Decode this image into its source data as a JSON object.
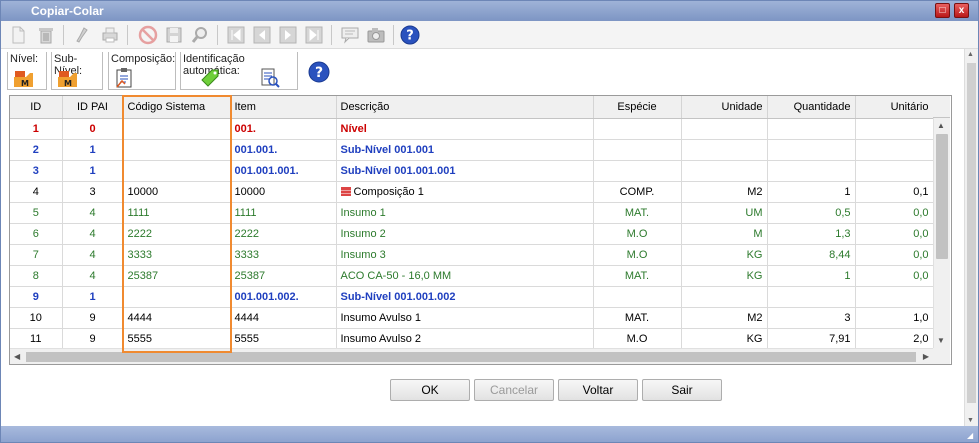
{
  "window": {
    "title": "Copiar-Colar"
  },
  "title_buttons": {
    "maximize": "□",
    "close": "x"
  },
  "toolbar": {
    "icons": [
      "new-file-icon",
      "trash-icon",
      "run-icon",
      "print-icon",
      "cancel-icon",
      "save-icon",
      "search-icon",
      "first-icon",
      "prev-icon",
      "next-icon",
      "last-icon",
      "comment-icon",
      "camera-icon",
      "help-icon"
    ]
  },
  "groups": {
    "nivel": "Nível:",
    "sub_nivel": "Sub-Nível:",
    "composicao": "Composição:",
    "identificacao": "Identificação automática:"
  },
  "table": {
    "columns": [
      "ID",
      "ID PAI",
      "Código Sistema",
      "Item",
      "Descrição",
      "Espécie",
      "Unidade",
      "Quantidade",
      "Unitário"
    ],
    "rows": [
      {
        "type": "red",
        "id": "1",
        "pai": "0",
        "codigo": "",
        "item": "001.",
        "desc": "Nível",
        "especie": "",
        "unidade": "",
        "qtd": "",
        "unit": ""
      },
      {
        "type": "blue",
        "id": "2",
        "pai": "1",
        "codigo": "",
        "item": "001.001.",
        "desc": "Sub-Nível 001.001",
        "especie": "",
        "unidade": "",
        "qtd": "",
        "unit": ""
      },
      {
        "type": "blue",
        "id": "3",
        "pai": "1",
        "codigo": "",
        "item": "001.001.001.",
        "desc": "Sub-Nível 001.001.001",
        "especie": "",
        "unidade": "",
        "qtd": "",
        "unit": ""
      },
      {
        "type": "black",
        "id": "4",
        "pai": "3",
        "codigo": "10000",
        "item": "10000",
        "desc": "Composição 1",
        "especie": "COMP.",
        "unidade": "M2",
        "qtd": "1",
        "unit": "0,1",
        "icon": true
      },
      {
        "type": "green",
        "id": "5",
        "pai": "4",
        "codigo": "1111",
        "item": "1111",
        "desc": "Insumo 1",
        "especie": "MAT.",
        "unidade": "UM",
        "qtd": "0,5",
        "unit": "0,0"
      },
      {
        "type": "green",
        "id": "6",
        "pai": "4",
        "codigo": "2222",
        "item": "2222",
        "desc": "Insumo 2",
        "especie": "M.O",
        "unidade": "M",
        "qtd": "1,3",
        "unit": "0,0"
      },
      {
        "type": "green",
        "id": "7",
        "pai": "4",
        "codigo": "3333",
        "item": "3333",
        "desc": "Insumo 3",
        "especie": "M.O",
        "unidade": "KG",
        "qtd": "8,44",
        "unit": "0,0"
      },
      {
        "type": "green",
        "id": "8",
        "pai": "4",
        "codigo": "25387",
        "item": "25387",
        "desc": "ACO CA-50 - 16,0 MM",
        "especie": "MAT.",
        "unidade": "KG",
        "qtd": "1",
        "unit": "0,0"
      },
      {
        "type": "blue",
        "id": "9",
        "pai": "1",
        "codigo": "",
        "item": "001.001.002.",
        "desc": "Sub-Nível 001.001.002",
        "especie": "",
        "unidade": "",
        "qtd": "",
        "unit": ""
      },
      {
        "type": "black",
        "id": "10",
        "pai": "9",
        "codigo": "4444",
        "item": "4444",
        "desc": "Insumo Avulso 1",
        "especie": "MAT.",
        "unidade": "M2",
        "qtd": "3",
        "unit": "1,0"
      },
      {
        "type": "black",
        "id": "11",
        "pai": "9",
        "codigo": "5555",
        "item": "5555",
        "desc": "Insumo Avulso 2",
        "especie": "M.O",
        "unidade": "KG",
        "qtd": "7,91",
        "unit": "2,0"
      }
    ]
  },
  "buttons": {
    "ok": "OK",
    "cancelar": "Cancelar",
    "voltar": "Voltar",
    "sair": "Sair"
  },
  "colors": {
    "accent": "#f08a30",
    "title_bar": "#8da3cf",
    "red_row": "#cc0000",
    "blue_row": "#1f3fbf",
    "green_row": "#2c7a2c"
  }
}
